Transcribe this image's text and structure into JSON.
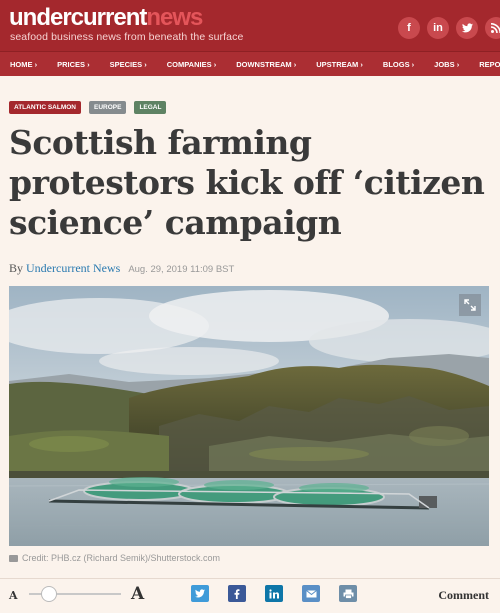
{
  "header": {
    "logo_part1": "undercurrent",
    "logo_part2": "news",
    "tagline": "seafood business news from beneath the surface",
    "social": [
      "f",
      "in",
      "t",
      "rss"
    ]
  },
  "nav": [
    "HOME",
    "PRICES",
    "SPECIES",
    "COMPANIES",
    "DOWNSTREAM",
    "UPSTREAM",
    "BLOGS",
    "JOBS",
    "REPOR"
  ],
  "tags": [
    "ATLANTIC SALMON",
    "EUROPE",
    "LEGAL"
  ],
  "article": {
    "title": "Scottish farming protestors kick off ‘citizen science’ campaign",
    "by": "By",
    "author": "Undercurrent News",
    "date": "Aug. 29, 2019 11:09 BST",
    "credit": "Credit: PHB.cz (Richard Semik)/Shutterstock.com"
  },
  "toolbar": {
    "font_small": "A",
    "font_large": "A",
    "comment_label": "Comment"
  },
  "colors": {
    "brand_red": "#a4282d",
    "twitter": "#3f9bd9",
    "facebook": "#3b5998",
    "linkedin": "#0e76a8",
    "email": "#5a8fc6",
    "print": "#6e8ea8"
  }
}
